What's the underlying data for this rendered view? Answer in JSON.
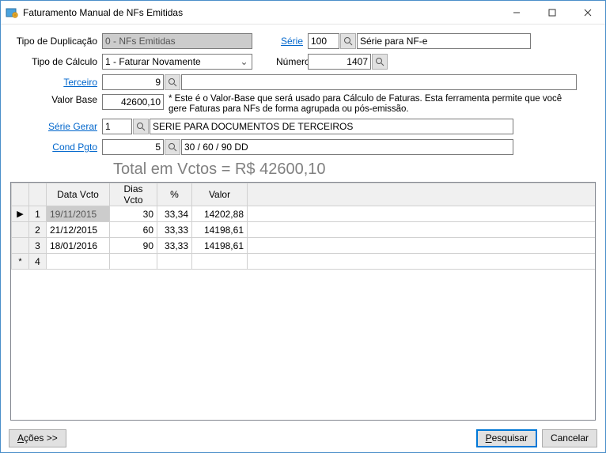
{
  "window": {
    "title": "Faturamento Manual de NFs Emitidas"
  },
  "labels": {
    "tipo_duplicacao": "Tipo de Duplicação",
    "tipo_calculo": "Tipo de Cálculo",
    "terceiro": "Terceiro",
    "valor_base": "Valor Base",
    "serie_gerar": "Série Gerar",
    "cond_pgto": "Cond Pgto",
    "serie": "Série",
    "numero": "Número"
  },
  "fields": {
    "tipo_duplicacao": "0 - NFs Emitidas",
    "tipo_calculo": "1 - Faturar Novamente",
    "serie": "100",
    "serie_desc": "Série para NF-e",
    "numero": "1407",
    "terceiro": "9",
    "terceiro_desc": "",
    "valor_base": "42600,10",
    "valor_base_note": "* Este é o Valor-Base que será usado para Cálculo de Faturas. Esta ferramenta permite que você gere Faturas para NFs de forma agrupada ou pós-emissão.",
    "serie_gerar": "1",
    "serie_gerar_desc": "SERIE PARA DOCUMENTOS DE TERCEIROS",
    "cond_pgto": "5",
    "cond_pgto_desc": "30 / 60 / 90 DD"
  },
  "total_line": "Total em Vctos = R$ 42600,10",
  "grid": {
    "headers": {
      "data_vcto": "Data Vcto",
      "dias_vcto": "Dias Vcto",
      "pct": "%",
      "valor": "Valor"
    },
    "rows": [
      {
        "n": "1",
        "marker": "▶",
        "data": "19/11/2015",
        "dias": "30",
        "pct": "33,34",
        "valor": "14202,88",
        "selected": true
      },
      {
        "n": "2",
        "marker": "",
        "data": "21/12/2015",
        "dias": "60",
        "pct": "33,33",
        "valor": "14198,61",
        "selected": false
      },
      {
        "n": "3",
        "marker": "",
        "data": "18/01/2016",
        "dias": "90",
        "pct": "33,33",
        "valor": "14198,61",
        "selected": false
      },
      {
        "n": "4",
        "marker": "*",
        "data": "",
        "dias": "",
        "pct": "",
        "valor": "",
        "selected": false
      }
    ]
  },
  "footer": {
    "acoes": "Ações >>",
    "pesquisar": "Pesquisar",
    "cancelar": "Cancelar"
  }
}
